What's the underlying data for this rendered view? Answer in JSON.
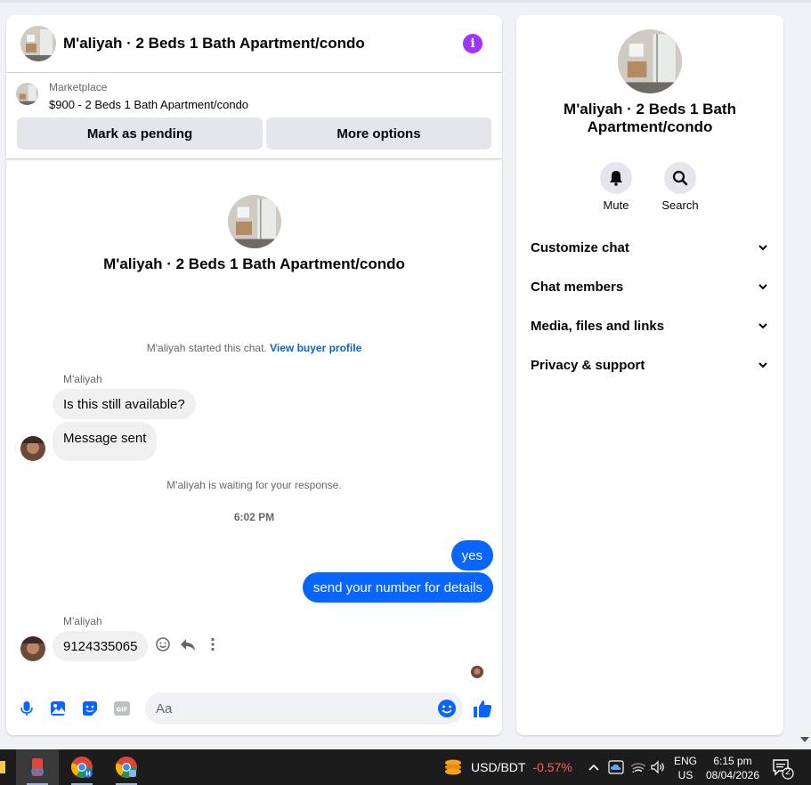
{
  "chat": {
    "title": "M'aliyah · 2 Beds 1 Bath Apartment/condo",
    "listing": {
      "category": "Marketplace",
      "price_title": "$900 - 2 Beds 1 Bath Apartment/condo",
      "mark_pending_label": "Mark as pending",
      "more_options_label": "More options"
    },
    "intro_name": "M'aliyah · 2 Beds 1 Bath Apartment/condo",
    "started_text": "M'aliyah started this chat.",
    "buyer_profile_link": "View buyer profile",
    "sender_name": "M'aliyah",
    "messages_in_1": [
      "Is this still available?",
      "Message sent"
    ],
    "waiting_text": "M'aliyah is waiting for your response.",
    "timestamp": "6:02 PM",
    "messages_out": [
      "yes",
      "send your number for details"
    ],
    "sender_name_2": "M'aliyah",
    "message_in_2": "9124335065",
    "composer_placeholder": "Aa"
  },
  "info_panel": {
    "name": "M'aliyah · 2 Beds 1 Bath Apartment/condo",
    "actions": [
      {
        "label": "Mute",
        "icon": "bell-icon"
      },
      {
        "label": "Search",
        "icon": "search-icon"
      }
    ],
    "sections": [
      "Customize chat",
      "Chat members",
      "Media, files and links",
      "Privacy & support"
    ]
  },
  "taskbar": {
    "currency_pair": "USD/BDT",
    "currency_change": "-0.57%",
    "lang_line1": "ENG",
    "lang_line2": "US",
    "time": "6:15 pm",
    "date": "08/04/2026",
    "notification_count": "2"
  },
  "colors": {
    "accent": "#0866ff",
    "info_purple": "#a033ff",
    "negative": "#ff5c5c"
  }
}
